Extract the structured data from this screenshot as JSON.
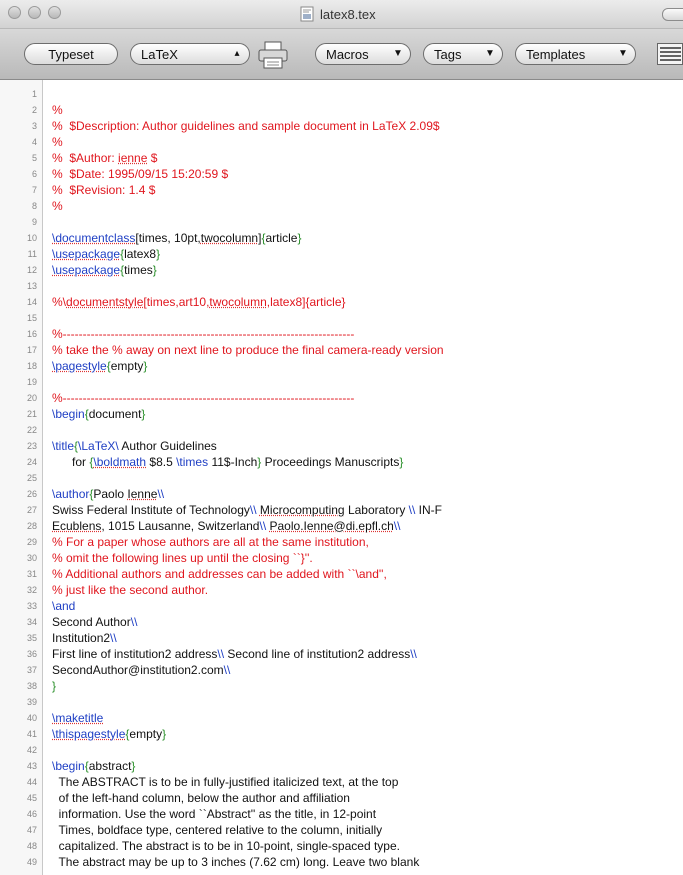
{
  "window": {
    "title": "latex8.tex"
  },
  "toolbar": {
    "typeset_label": "Typeset",
    "format_value": "LaTeX",
    "macros_label": "Macros",
    "tags_label": "Tags",
    "templates_label": "Templates"
  },
  "colors": {
    "comment": "#e0161e",
    "command": "#1f3fc4",
    "brace": "#2a8f2a",
    "text": "#111111"
  },
  "lines": [
    {
      "n": "1",
      "segs": []
    },
    {
      "n": "2",
      "segs": [
        {
          "t": "%",
          "c": "c"
        }
      ]
    },
    {
      "n": "3",
      "segs": [
        {
          "t": "%  $Description: Author guidelines and sample document in LaTeX 2.09$",
          "c": "c"
        }
      ]
    },
    {
      "n": "4",
      "segs": [
        {
          "t": "%",
          "c": "c"
        }
      ]
    },
    {
      "n": "5",
      "segs": [
        {
          "t": "%  $Author: ",
          "c": "c"
        },
        {
          "t": "ienne",
          "c": "c u"
        },
        {
          "t": " $",
          "c": "c"
        }
      ]
    },
    {
      "n": "6",
      "segs": [
        {
          "t": "%  $Date: 1995/09/15 15:20:59 $",
          "c": "c"
        }
      ]
    },
    {
      "n": "7",
      "segs": [
        {
          "t": "%  $Revision: 1.4 $",
          "c": "c"
        }
      ]
    },
    {
      "n": "8",
      "segs": [
        {
          "t": "%",
          "c": "c"
        }
      ]
    },
    {
      "n": "9",
      "segs": []
    },
    {
      "n": "10",
      "segs": [
        {
          "t": "\\documentclass",
          "c": "k"
        },
        {
          "t": "[times, 10pt,",
          "c": "t"
        },
        {
          "t": "twocolumn",
          "c": "t u"
        },
        {
          "t": "]",
          "c": "t"
        },
        {
          "t": "{",
          "c": "g"
        },
        {
          "t": "article",
          "c": "t"
        },
        {
          "t": "}",
          "c": "g"
        }
      ]
    },
    {
      "n": "11",
      "segs": [
        {
          "t": "\\usepackage",
          "c": "k"
        },
        {
          "t": "{",
          "c": "g"
        },
        {
          "t": "latex8",
          "c": "t"
        },
        {
          "t": "}",
          "c": "g"
        }
      ]
    },
    {
      "n": "12",
      "segs": [
        {
          "t": "\\usepackage",
          "c": "k"
        },
        {
          "t": "{",
          "c": "g"
        },
        {
          "t": "times",
          "c": "t"
        },
        {
          "t": "}",
          "c": "g"
        }
      ]
    },
    {
      "n": "13",
      "segs": []
    },
    {
      "n": "14",
      "segs": [
        {
          "t": "%\\",
          "c": "c"
        },
        {
          "t": "documentstyle",
          "c": "c u"
        },
        {
          "t": "[times,art10,",
          "c": "c"
        },
        {
          "t": "twocolumn",
          "c": "c u"
        },
        {
          "t": ",latex8]{article}",
          "c": "c"
        }
      ]
    },
    {
      "n": "15",
      "segs": []
    },
    {
      "n": "16",
      "segs": [
        {
          "t": "%-------------------------------------------------------------------------",
          "c": "c"
        }
      ]
    },
    {
      "n": "17",
      "segs": [
        {
          "t": "% take the % away on next line to produce the final camera-ready version",
          "c": "c"
        }
      ]
    },
    {
      "n": "18",
      "segs": [
        {
          "t": "\\pagestyle",
          "c": "k"
        },
        {
          "t": "{",
          "c": "g"
        },
        {
          "t": "empty",
          "c": "t"
        },
        {
          "t": "}",
          "c": "g"
        }
      ]
    },
    {
      "n": "19",
      "segs": []
    },
    {
      "n": "20",
      "segs": [
        {
          "t": "%-------------------------------------------------------------------------",
          "c": "c"
        }
      ]
    },
    {
      "n": "21",
      "segs": [
        {
          "t": "\\begin",
          "c": "kp"
        },
        {
          "t": "{",
          "c": "g"
        },
        {
          "t": "document",
          "c": "t"
        },
        {
          "t": "}",
          "c": "g"
        }
      ]
    },
    {
      "n": "22",
      "segs": []
    },
    {
      "n": "23",
      "segs": [
        {
          "t": "\\title",
          "c": "kp"
        },
        {
          "t": "{",
          "c": "g"
        },
        {
          "t": "\\LaTeX\\",
          "c": "kp"
        },
        {
          "t": " Author Guidelines",
          "c": "t"
        }
      ]
    },
    {
      "n": "24",
      "segs": [
        {
          "t": "      for ",
          "c": "t"
        },
        {
          "t": "{",
          "c": "g"
        },
        {
          "t": "\\boldmath",
          "c": "k"
        },
        {
          "t": " $8.5 ",
          "c": "t"
        },
        {
          "t": "\\times",
          "c": "kp"
        },
        {
          "t": " 11$-Inch",
          "c": "t"
        },
        {
          "t": "}",
          "c": "g"
        },
        {
          "t": " Proceedings Manuscripts",
          "c": "t"
        },
        {
          "t": "}",
          "c": "g"
        }
      ]
    },
    {
      "n": "25",
      "segs": []
    },
    {
      "n": "26",
      "segs": [
        {
          "t": "\\author",
          "c": "kp"
        },
        {
          "t": "{",
          "c": "g"
        },
        {
          "t": "Paolo ",
          "c": "t"
        },
        {
          "t": "Ienne",
          "c": "t u"
        },
        {
          "t": "\\\\",
          "c": "kp"
        }
      ]
    },
    {
      "n": "27",
      "segs": [
        {
          "t": "Swiss Federal Institute of Technology",
          "c": "t"
        },
        {
          "t": "\\\\",
          "c": "kp"
        },
        {
          "t": " ",
          "c": "t"
        },
        {
          "t": "Microcomputing",
          "c": "t u"
        },
        {
          "t": " Laboratory ",
          "c": "t"
        },
        {
          "t": "\\\\",
          "c": "kp"
        },
        {
          "t": " IN-F",
          "c": "t"
        }
      ]
    },
    {
      "n": "28",
      "segs": [
        {
          "t": "Ecublens",
          "c": "t u"
        },
        {
          "t": ", 1015 Lausanne, Switzerland",
          "c": "t"
        },
        {
          "t": "\\\\",
          "c": "kp"
        },
        {
          "t": " ",
          "c": "t"
        },
        {
          "t": "Paolo.Ienne@di.epfl.ch",
          "c": "t u"
        },
        {
          "t": "\\\\",
          "c": "kp"
        }
      ]
    },
    {
      "n": "29",
      "segs": [
        {
          "t": "% For a paper whose authors are all at the same institution,",
          "c": "c"
        }
      ]
    },
    {
      "n": "30",
      "segs": [
        {
          "t": "% omit the following lines up until the closing ``}''.",
          "c": "c"
        }
      ]
    },
    {
      "n": "31",
      "segs": [
        {
          "t": "% Additional authors and addresses can be added with ``\\and'',",
          "c": "c"
        }
      ]
    },
    {
      "n": "32",
      "segs": [
        {
          "t": "% just like the second author.",
          "c": "c"
        }
      ]
    },
    {
      "n": "33",
      "segs": [
        {
          "t": "\\and",
          "c": "kp"
        }
      ]
    },
    {
      "n": "34",
      "segs": [
        {
          "t": "Second Author",
          "c": "t"
        },
        {
          "t": "\\\\",
          "c": "kp"
        }
      ]
    },
    {
      "n": "35",
      "segs": [
        {
          "t": "Institution2",
          "c": "t"
        },
        {
          "t": "\\\\",
          "c": "kp"
        }
      ]
    },
    {
      "n": "36",
      "segs": [
        {
          "t": "First line of institution2 address",
          "c": "t"
        },
        {
          "t": "\\\\",
          "c": "kp"
        },
        {
          "t": " Second line of institution2 address",
          "c": "t"
        },
        {
          "t": "\\\\",
          "c": "kp"
        }
      ]
    },
    {
      "n": "37",
      "segs": [
        {
          "t": "SecondAuthor@institution2.com",
          "c": "t"
        },
        {
          "t": "\\\\",
          "c": "kp"
        }
      ]
    },
    {
      "n": "38",
      "segs": [
        {
          "t": "}",
          "c": "g"
        }
      ]
    },
    {
      "n": "39",
      "segs": []
    },
    {
      "n": "40",
      "segs": [
        {
          "t": "\\maketitle",
          "c": "k"
        }
      ]
    },
    {
      "n": "41",
      "segs": [
        {
          "t": "\\thispagestyle",
          "c": "k"
        },
        {
          "t": "{",
          "c": "g"
        },
        {
          "t": "empty",
          "c": "t"
        },
        {
          "t": "}",
          "c": "g"
        }
      ]
    },
    {
      "n": "42",
      "segs": []
    },
    {
      "n": "43",
      "segs": [
        {
          "t": "\\begin",
          "c": "kp"
        },
        {
          "t": "{",
          "c": "g"
        },
        {
          "t": "abstract",
          "c": "t"
        },
        {
          "t": "}",
          "c": "g"
        }
      ]
    },
    {
      "n": "44",
      "segs": [
        {
          "t": "  The ABSTRACT is to be in fully-justified italicized text, at the top",
          "c": "t"
        }
      ]
    },
    {
      "n": "45",
      "segs": [
        {
          "t": "  of the left-hand column, below the author and affiliation",
          "c": "t"
        }
      ]
    },
    {
      "n": "46",
      "segs": [
        {
          "t": "  information. Use the word ``Abstract'' as the title, in 12-point",
          "c": "t"
        }
      ]
    },
    {
      "n": "47",
      "segs": [
        {
          "t": "  Times, boldface type, centered relative to the column, initially",
          "c": "t"
        }
      ]
    },
    {
      "n": "48",
      "segs": [
        {
          "t": "  capitalized. The abstract is to be in 10-point, single-spaced type.",
          "c": "t"
        }
      ]
    },
    {
      "n": "49",
      "segs": [
        {
          "t": "  The abstract may be up to 3 inches (7.62 cm) long. Leave two blank",
          "c": "t"
        }
      ]
    }
  ]
}
